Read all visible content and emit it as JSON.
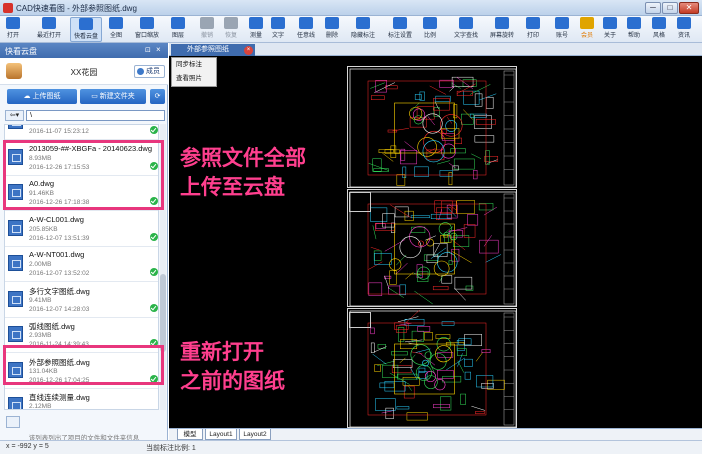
{
  "window": {
    "title": "CAD快速看图 - 外部参照图纸.dwg",
    "min_glyph": "─",
    "max_glyph": "□",
    "close_glyph": "✕"
  },
  "toolbar": {
    "items": [
      {
        "label": "打开",
        "icon": "folder-open-icon",
        "color": "#2b6fd0"
      },
      {
        "label": "最近打开",
        "icon": "clock-history-icon",
        "color": "#2b6fd0"
      },
      {
        "label": "快看云盘",
        "icon": "cloud-icon",
        "color": "#2b6fd0"
      },
      {
        "label": "全图",
        "icon": "fit-extents-icon",
        "color": "#2b6fd0"
      },
      {
        "label": "窗口缩放",
        "icon": "zoom-window-icon",
        "color": "#2b6fd0"
      },
      {
        "label": "图层",
        "icon": "layers-icon",
        "color": "#2b6fd0"
      },
      {
        "label": "撤销",
        "icon": "undo-icon",
        "color": "#9aa5b3"
      },
      {
        "label": "恢复",
        "icon": "redo-icon",
        "color": "#9aa5b3"
      },
      {
        "label": "测量",
        "icon": "measure-icon",
        "color": "#2b6fd0"
      },
      {
        "label": "文字",
        "icon": "text-icon",
        "color": "#2b6fd0"
      },
      {
        "label": "任意线",
        "icon": "freehand-line-icon",
        "color": "#2b6fd0"
      },
      {
        "label": "删除",
        "icon": "eraser-icon",
        "color": "#2b6fd0"
      },
      {
        "label": "隐藏标注",
        "icon": "hide-annotation-icon",
        "color": "#2b6fd0"
      },
      {
        "label": "标注设置",
        "icon": "annotation-settings-icon",
        "color": "#2b6fd0"
      },
      {
        "label": "比例",
        "icon": "scale-icon",
        "color": "#2b6fd0"
      },
      {
        "label": "文字查找",
        "icon": "text-search-icon",
        "color": "#2b6fd0"
      },
      {
        "label": "屏幕旋转",
        "icon": "rotate-screen-icon",
        "color": "#2b6fd0"
      },
      {
        "label": "打印",
        "icon": "printer-icon",
        "color": "#2b6fd0"
      },
      {
        "label": "账号",
        "icon": "user-account-icon",
        "color": "#2b6fd0"
      },
      {
        "label": "会员",
        "icon": "vip-icon",
        "color": "#e0a400"
      },
      {
        "label": "关于",
        "icon": "info-icon",
        "color": "#2b6fd0"
      },
      {
        "label": "帮助",
        "icon": "help-icon",
        "color": "#2b6fd0"
      },
      {
        "label": "风格",
        "icon": "style-icon",
        "color": "#2b6fd0"
      },
      {
        "label": "资讯",
        "icon": "news-icon",
        "color": "#2b6fd0"
      }
    ]
  },
  "panel": {
    "title": "快看云盘",
    "pin_glyph": "⊡",
    "close_glyph": "×",
    "project_name": "XX花园",
    "members_label": "成员",
    "upload_label": "上传图纸",
    "new_folder_label": "新建文件夹",
    "refresh_glyph": "⟳",
    "back_glyph": "⇦▾",
    "path_value": "\\",
    "files": [
      {
        "name": "",
        "size": "",
        "date": "2016-11-07 15:23:12",
        "status": "synced"
      },
      {
        "name": "2013059-##-XBGFa - 20140623.dwg",
        "size": "8.93MB",
        "date": "2016-12-26 17:15:53",
        "status": "synced"
      },
      {
        "name": "A0.dwg",
        "size": "91.46KB",
        "date": "2016-12-26 17:18:38",
        "status": "synced"
      },
      {
        "name": "A-W-CL001.dwg",
        "size": "205.85KB",
        "date": "2016-12-07 13:51:39",
        "status": "synced"
      },
      {
        "name": "A-W-NT001.dwg",
        "size": "2.00MB",
        "date": "2016-12-07 13:52:02",
        "status": "synced"
      },
      {
        "name": "多行文字图纸.dwg",
        "size": "9.41MB",
        "date": "2016-12-07 14:28:03",
        "status": "synced"
      },
      {
        "name": "弧线图纸.dwg",
        "size": "2.93MB",
        "date": "2016-11-24 14:39:43",
        "status": "synced"
      },
      {
        "name": "外部参照图纸.dwg",
        "size": "131.04KB",
        "date": "2016-12-26 17:04:25",
        "status": "synced"
      },
      {
        "name": "直线连续测量.dwg",
        "size": "2.12MB",
        "date": "",
        "status": "synced"
      }
    ],
    "hint": "该列表列出了项目的文件和文件夹信息"
  },
  "document": {
    "tab_label": "外部参照图纸",
    "tab_close_glyph": "×",
    "context_menu": [
      "同步标注",
      "查看照片"
    ]
  },
  "annotations": {
    "top": [
      "参照文件全部",
      "上传至云盘"
    ],
    "bottom": [
      "重新打开",
      "之前的图纸"
    ],
    "color": "#ff3f8e"
  },
  "layout_tabs": [
    "模型",
    "Layout1",
    "Layout2"
  ],
  "status": {
    "coords": "x = -992  y = 5",
    "scale": "当前标注比例: 1"
  }
}
